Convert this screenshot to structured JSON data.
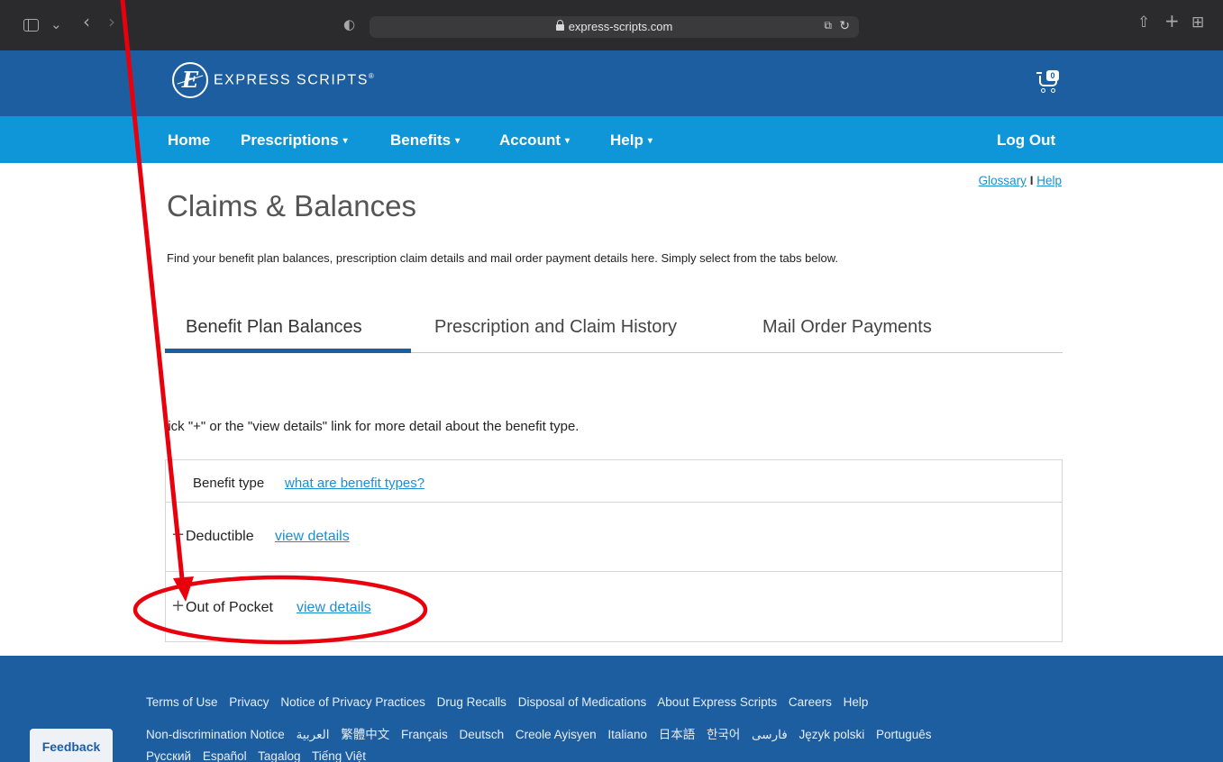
{
  "browser": {
    "url": "express-scripts.com",
    "icons": [
      "sidebar-icon",
      "chevron-down-icon",
      "back-icon",
      "forward-icon",
      "shield-icon",
      "lock-icon",
      "translate-icon",
      "reload-icon",
      "share-icon",
      "new-tab-icon",
      "tab-overview-icon"
    ],
    "glyphs": {
      "chevron_down": "⌄",
      "back": "‹",
      "forward": "›",
      "shield": "◐",
      "translate": "⧉",
      "reload": "↻",
      "share": "⇧",
      "new_tab": "+",
      "tabs": "⊞"
    }
  },
  "header": {
    "logo_letter": "E",
    "brand": "EXPRESS SCRIPTS",
    "brand_mark": "®",
    "cart_count": "0"
  },
  "nav": {
    "items": [
      {
        "label": "Home",
        "has_caret": false
      },
      {
        "label": "Prescriptions",
        "has_caret": true
      },
      {
        "label": "Benefits",
        "has_caret": true
      },
      {
        "label": "Account",
        "has_caret": true
      },
      {
        "label": "Help",
        "has_caret": true
      }
    ],
    "caret": "▾",
    "logout": "Log Out"
  },
  "links": {
    "glossary": "Glossary",
    "separator": "I",
    "help": "Help"
  },
  "page": {
    "title": "Claims & Balances",
    "intro": "Find your benefit plan balances, prescription claim details and mail order payment details here. Simply select from the tabs below."
  },
  "tabs": {
    "items": [
      "Benefit Plan Balances",
      "Prescription and Claim History",
      "Mail Order Payments"
    ],
    "active": "Benefit Plan Balances"
  },
  "balances": {
    "instruction": "lick \"+\" or the \"view details\" link for more detail about the benefit type.",
    "header_label": "Benefit type",
    "header_link": "what are benefit types?",
    "expand_symbol": "+",
    "rows": [
      {
        "name": "Deductible",
        "link": "view details"
      },
      {
        "name": "Out of Pocket",
        "link": "view details"
      }
    ]
  },
  "footer": {
    "row1": [
      "Terms of Use",
      "Privacy",
      "Notice of Privacy Practices",
      "Drug Recalls",
      "Disposal of Medications",
      "About Express Scripts",
      "Careers",
      "Help"
    ],
    "row2": [
      "Non-discrimination Notice",
      "العربية",
      "繁體中文",
      "Français",
      "Deutsch",
      "Creole Ayisyen",
      "Italiano",
      "日本語",
      "한국어",
      "فارسی",
      "Język polski",
      "Português"
    ],
    "row3": [
      "Русский",
      "Español",
      "Tagalog",
      "Tiếng Việt"
    ],
    "feedback": "Feedback"
  },
  "annotation": {
    "color": "#e8000d",
    "shapes": [
      "arrow",
      "ellipse"
    ],
    "highlights": "Out of Pocket"
  }
}
